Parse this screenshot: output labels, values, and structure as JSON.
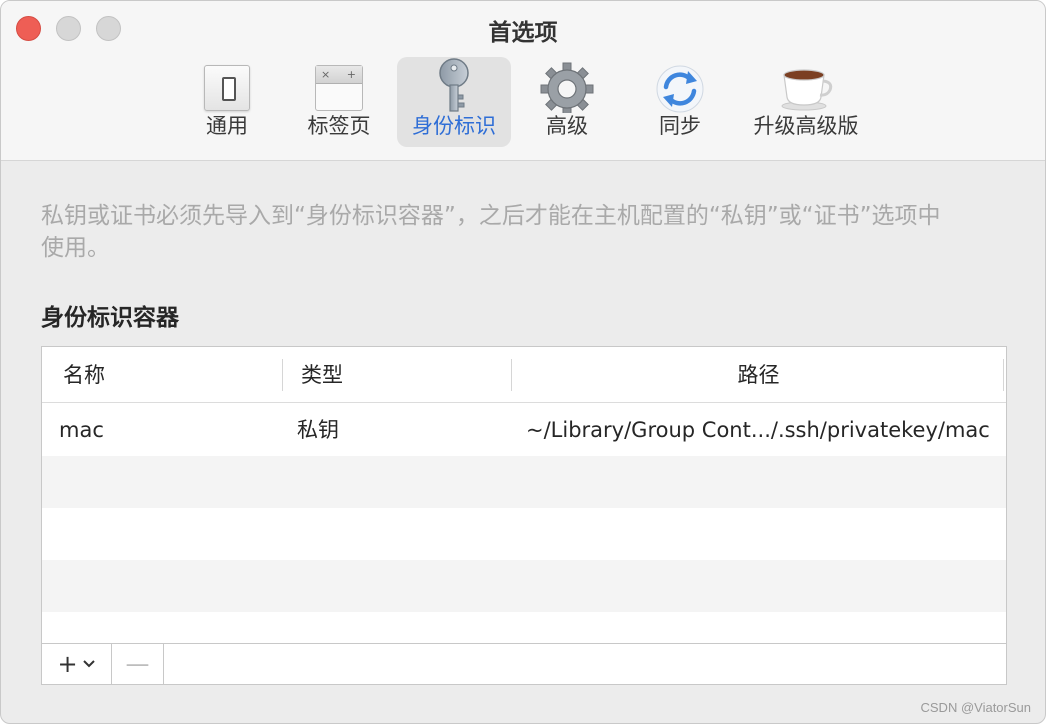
{
  "window": {
    "title": "首选项"
  },
  "toolbar": {
    "items": [
      {
        "label": "通用",
        "icon": "switch-icon"
      },
      {
        "label": "标签页",
        "icon": "tabs-icon"
      },
      {
        "label": "身份标识",
        "icon": "key-icon",
        "active": true
      },
      {
        "label": "高级",
        "icon": "gear-icon"
      },
      {
        "label": "同步",
        "icon": "sync-icon"
      },
      {
        "label": "升级高级版",
        "icon": "coffee-cup-icon"
      }
    ],
    "active_color": "#2f6ed6"
  },
  "content": {
    "description": "私钥或证书必须先导入到“身份标识容器”，之后才能在主机配置的“私钥”或“证书”选项中使用。",
    "section_title": "身份标识容器"
  },
  "table": {
    "columns": [
      "名称",
      "类型",
      "路径"
    ],
    "rows": [
      {
        "name": "mac",
        "type": "私钥",
        "path": "~/Library/Group Cont.../.ssh/privatekey/mac"
      }
    ]
  },
  "bottom_bar": {
    "add_label": "+",
    "remove_label": "—"
  },
  "watermark": "CSDN @ViatorSun",
  "colors": {
    "close": "#ee5e55",
    "accent": "#2f6ed6"
  }
}
